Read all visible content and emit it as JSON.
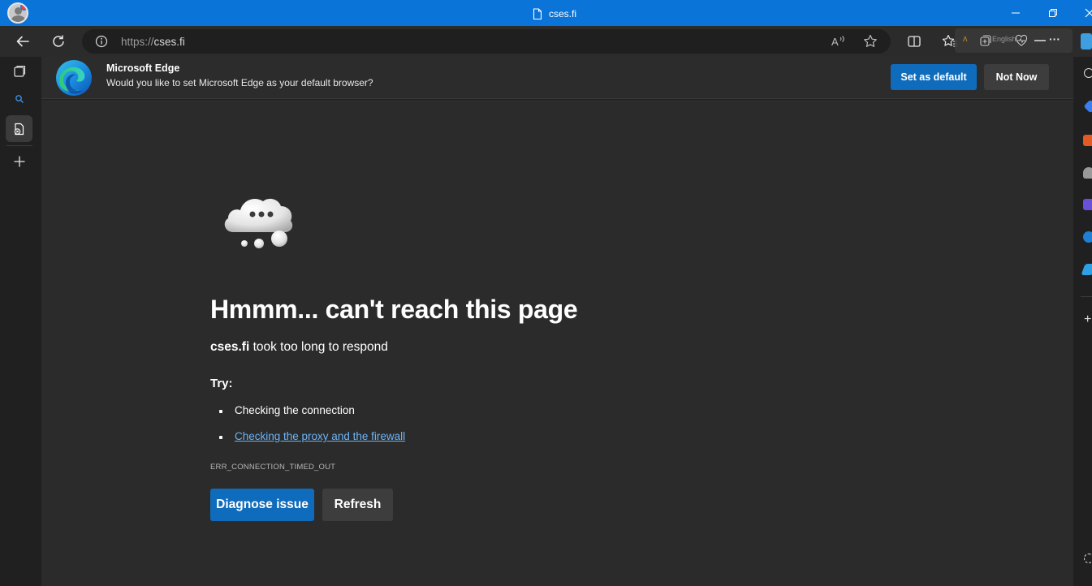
{
  "window": {
    "tab_title": "cses.fi"
  },
  "toolbar": {
    "url_protocol": "https://",
    "url_host": "cses.fi",
    "extension_language": "English"
  },
  "infobar": {
    "title": "Microsoft Edge",
    "message": "Would you like to set Microsoft Edge as your default browser?",
    "set_default_label": "Set as default",
    "not_now_label": "Not Now"
  },
  "error_page": {
    "heading": "Hmmm... can't reach this page",
    "host": "cses.fi",
    "subtitle_rest": " took too long to respond",
    "try_label": "Try:",
    "tips": [
      "Checking the connection",
      "Checking the proxy and the firewall"
    ],
    "error_code": "ERR_CONNECTION_TIMED_OUT",
    "diagnose_label": "Diagnose issue",
    "refresh_label": "Refresh"
  },
  "colors": {
    "titlebar": "#0a74d9",
    "accent_button": "#0f6cbd",
    "link": "#6cb4f5",
    "page_background": "#2b2b2b"
  }
}
